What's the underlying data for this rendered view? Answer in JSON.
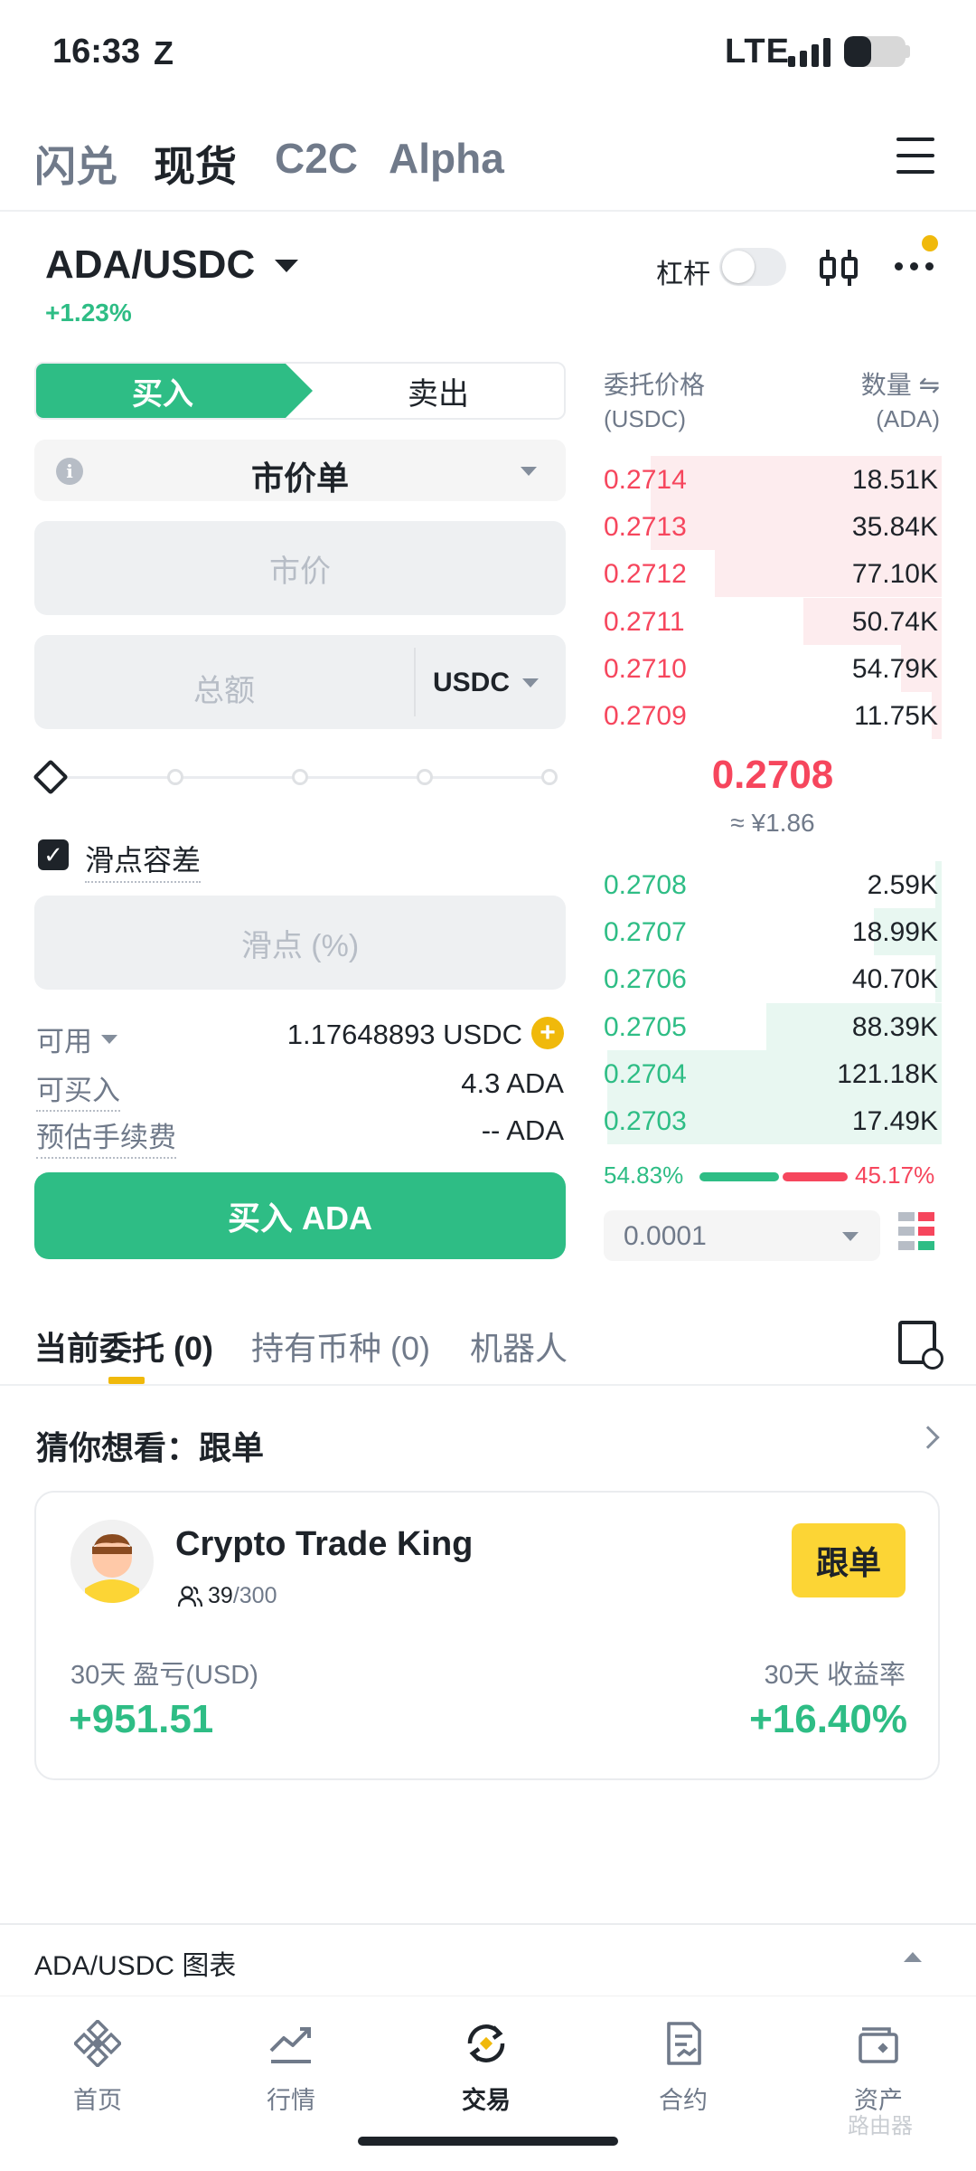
{
  "status_bar": {
    "time": "16:33",
    "network": "LTE",
    "app_badge": "Z"
  },
  "top_tabs": [
    {
      "label": "闪兑",
      "active": false
    },
    {
      "label": "现货",
      "active": true
    },
    {
      "label": "C2C",
      "active": false
    },
    {
      "label": "Alpha",
      "active": false
    }
  ],
  "pair": {
    "symbol": "ADA/USDC",
    "change": "+1.23%",
    "leverage_label": "杠杆",
    "leverage_on": false
  },
  "form": {
    "buy_label": "买入",
    "sell_label": "卖出",
    "order_type": "市价单",
    "price_placeholder": "市价",
    "total_placeholder": "总额",
    "total_unit": "USDC",
    "slippage_label": "滑点容差",
    "slippage_checked": true,
    "slippage_placeholder": "滑点 (%)",
    "available_label": "可用",
    "available_value": "1.17648893 USDC",
    "can_buy_label": "可买入",
    "can_buy_value": "4.3 ADA",
    "fee_label": "预估手续费",
    "fee_value": "-- ADA",
    "submit_label": "买入 ADA"
  },
  "orderbook": {
    "price_header": "委托价格",
    "price_unit": "(USDC)",
    "qty_header": "数量 ⇋",
    "qty_unit": "(ADA)",
    "asks": [
      {
        "price": "0.2714",
        "qty": "18.51K",
        "depth": 0.86
      },
      {
        "price": "0.2713",
        "qty": "35.84K",
        "depth": 0.86
      },
      {
        "price": "0.2712",
        "qty": "77.10K",
        "depth": 0.67
      },
      {
        "price": "0.2711",
        "qty": "50.74K",
        "depth": 0.41
      },
      {
        "price": "0.2710",
        "qty": "54.79K",
        "depth": 0.12
      },
      {
        "price": "0.2709",
        "qty": "11.75K",
        "depth": 0.03
      }
    ],
    "last_price": "0.2708",
    "last_price_cny": "≈ ¥1.86",
    "bids": [
      {
        "price": "0.2708",
        "qty": "2.59K",
        "depth": 0.02
      },
      {
        "price": "0.2707",
        "qty": "18.99K",
        "depth": 0.2
      },
      {
        "price": "0.2706",
        "qty": "40.70K",
        "depth": 0.02
      },
      {
        "price": "0.2705",
        "qty": "88.39K",
        "depth": 0.52
      },
      {
        "price": "0.2704",
        "qty": "121.18K",
        "depth": 0.99
      },
      {
        "price": "0.2703",
        "qty": "17.49K",
        "depth": 0.99
      }
    ],
    "buy_ratio": "54.83%",
    "sell_ratio": "45.17%",
    "tick_size": "0.0001"
  },
  "bottom_tabs": [
    {
      "label": "当前委托 (0)",
      "active": true
    },
    {
      "label": "持有币种 (0)",
      "active": false
    },
    {
      "label": "机器人",
      "active": false
    }
  ],
  "guess": {
    "title": "猜你想看：跟单",
    "trader_name": "Crypto Trade King",
    "followers": "39",
    "followers_max": "/300",
    "follow_button": "跟单",
    "pnl_label": "30天 盈亏(USD)",
    "pnl_value": "+951.51",
    "roi_label": "30天 收益率",
    "roi_value": "+16.40%"
  },
  "chart_bar": {
    "label": "ADA/USDC 图表"
  },
  "nav": [
    {
      "label": "首页",
      "icon": "home-icon",
      "active": false
    },
    {
      "label": "行情",
      "icon": "markets-icon",
      "active": false
    },
    {
      "label": "交易",
      "icon": "trade-icon",
      "active": true
    },
    {
      "label": "合约",
      "icon": "futures-icon",
      "active": false
    },
    {
      "label": "资产",
      "icon": "wallet-icon",
      "active": false
    }
  ],
  "watermark": "路由器",
  "colors": {
    "green": "#2ebd85",
    "red": "#f6465d",
    "yellow": "#f0b90b",
    "text": "#1e2329",
    "muted": "#707a8a"
  }
}
